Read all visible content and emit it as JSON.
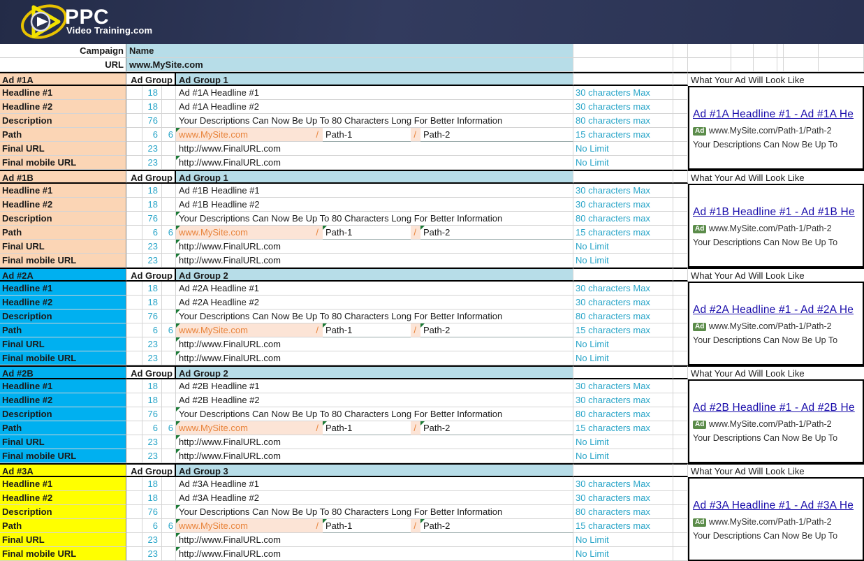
{
  "brand": {
    "name_main": "PPC",
    "name_sub": "Video Training.com",
    "logo_icon": "play-button-swoosh-icon",
    "banner_color": "#2b3352",
    "accent_color": "#e8c200"
  },
  "top_fields": [
    {
      "label": "Campaign",
      "value": "Name"
    },
    {
      "label": "URL",
      "value": "www.MySite.com"
    }
  ],
  "group_label": "Ad Group",
  "preview_header": "What Your Ad Will Look Like",
  "limits": {
    "headline1": "30 characters Max",
    "headline2": "30 characters max",
    "description": "80 characters max",
    "path": "15 characters max",
    "final_url": "No Limit",
    "final_mobile_url": "No Limit"
  },
  "row_labels": {
    "headline1": "Headline #1",
    "headline2": "Headline #2",
    "description": "Description",
    "path": "Path",
    "final_url": "Final URL",
    "final_mobile_url": "Final mobile URL"
  },
  "counts": {
    "headline1": "18",
    "headline2": "18",
    "description": "76",
    "path_a": "6",
    "path_b": "6",
    "final_url": "23",
    "final_mobile_url": "23"
  },
  "shared": {
    "description_text": "Your Descriptions Can Now Be Up To 80 Characters Long For Better Information",
    "path_domain": "www.MySite.com",
    "path_1": "Path-1",
    "path_2": "Path-2",
    "slash": "/",
    "final_url": "http://www.FinalURL.com",
    "final_mobile_url": "http://www.FinalURL.com",
    "preview_url": "www.MySite.com/Path-1/Path-2",
    "preview_ad_badge": "Ad",
    "preview_desc": "Your Descriptions Can Now Be Up To"
  },
  "blocks": [
    {
      "id": "ad-1a",
      "title": "Ad #1A",
      "title_color": "#fbd5b5",
      "ad_group": "Ad Group 1",
      "headline1": "Ad #1A Headline #1",
      "headline2": "Ad #1A Headline #2",
      "preview_title": "Ad #1A Headline #1 - Ad #1A He"
    },
    {
      "id": "ad-1b",
      "title": "Ad #1B",
      "title_color": "#fbd5b5",
      "ad_group": "Ad Group 1",
      "headline1": "Ad #1B Headline #1",
      "headline2": "Ad #1B Headline #2",
      "preview_title": "Ad #1B Headline #1 - Ad #1B He"
    },
    {
      "id": "ad-2a",
      "title": "Ad #2A",
      "title_color": "#00b0f0",
      "ad_group": "Ad Group 2",
      "headline1": "Ad #2A Headline #1",
      "headline2": "Ad #2A Headline #2",
      "preview_title": "Ad #2A Headline #1 - Ad #2A He"
    },
    {
      "id": "ad-2b",
      "title": "Ad #2B",
      "title_color": "#00b0f0",
      "ad_group": "Ad Group 2",
      "headline1": "Ad #2B Headline #1",
      "headline2": "Ad #2B Headline #2",
      "preview_title": "Ad #2B Headline #1 - Ad #2B He"
    },
    {
      "id": "ad-3a",
      "title": "Ad #3A",
      "title_color": "#ffff00",
      "ad_group": "Ad Group 3",
      "headline1": "Ad #3A Headline #1",
      "headline2": "Ad #3A Headline #2",
      "preview_title": "Ad #3A Headline #1 - Ad #3A He"
    }
  ]
}
